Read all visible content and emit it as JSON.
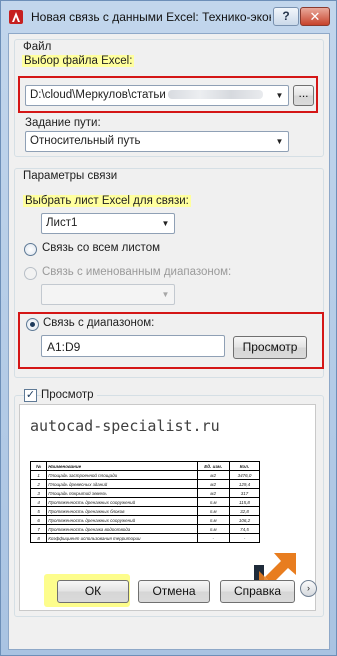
{
  "window": {
    "title": "Новая связь с данными Excel: Технико-эконо...",
    "help_label": "?",
    "close_label": "✕"
  },
  "file_group": {
    "title": "Файл",
    "select_label": "Выбор файла Excel:",
    "file_path": "D:\\cloud\\Меркулов\\статьи",
    "browse_label": "...",
    "path_type_label": "Задание пути:",
    "path_type_value": "Относительный путь"
  },
  "link_group": {
    "title": "Параметры связи",
    "sheet_label": "Выбрать лист Excel для связи:",
    "sheet_value": "Лист1",
    "option_whole_sheet": "Связь со всем листом",
    "option_named_range": "Связь с именованным диапазоном:",
    "option_range": "Связь с диапазоном:",
    "range_value": "A1:D9",
    "preview_button": "Просмотр"
  },
  "preview": {
    "checkbox_label": "Просмотр",
    "site_text": "autocad-specialist.ru",
    "sheet_rows": [
      [
        "№",
        "Наименование",
        "Ед. изм.",
        "Кол."
      ],
      [
        "1",
        "Площадь застроенной площади",
        "м2",
        "3476,0"
      ],
      [
        "2",
        "Площадь древесных зданий",
        "м2",
        "129,4"
      ],
      [
        "3",
        "Площадь покрытий земель",
        "м2",
        "317"
      ],
      [
        "4",
        "Протяженность дренажных сооружений",
        "п.м",
        "115,8"
      ],
      [
        "5",
        "Протяженность дренажных блоков",
        "п.м",
        "32,8"
      ],
      [
        "6",
        "Протяженность дренажных сооружений",
        "п.м",
        "106,2"
      ],
      [
        "7",
        "Протяженность дренажа водоотвода",
        "п.м",
        "74,5"
      ],
      [
        "8",
        "Коэффициент использования территории",
        "-",
        "-"
      ]
    ]
  },
  "footer": {
    "ok_label": "ОК",
    "cancel_label": "Отмена",
    "help_label": "Справка",
    "more_label": "›"
  },
  "colors": {
    "highlight": "#ffff9e",
    "annotation_red": "#d41616",
    "close_red": "#c7432c"
  }
}
